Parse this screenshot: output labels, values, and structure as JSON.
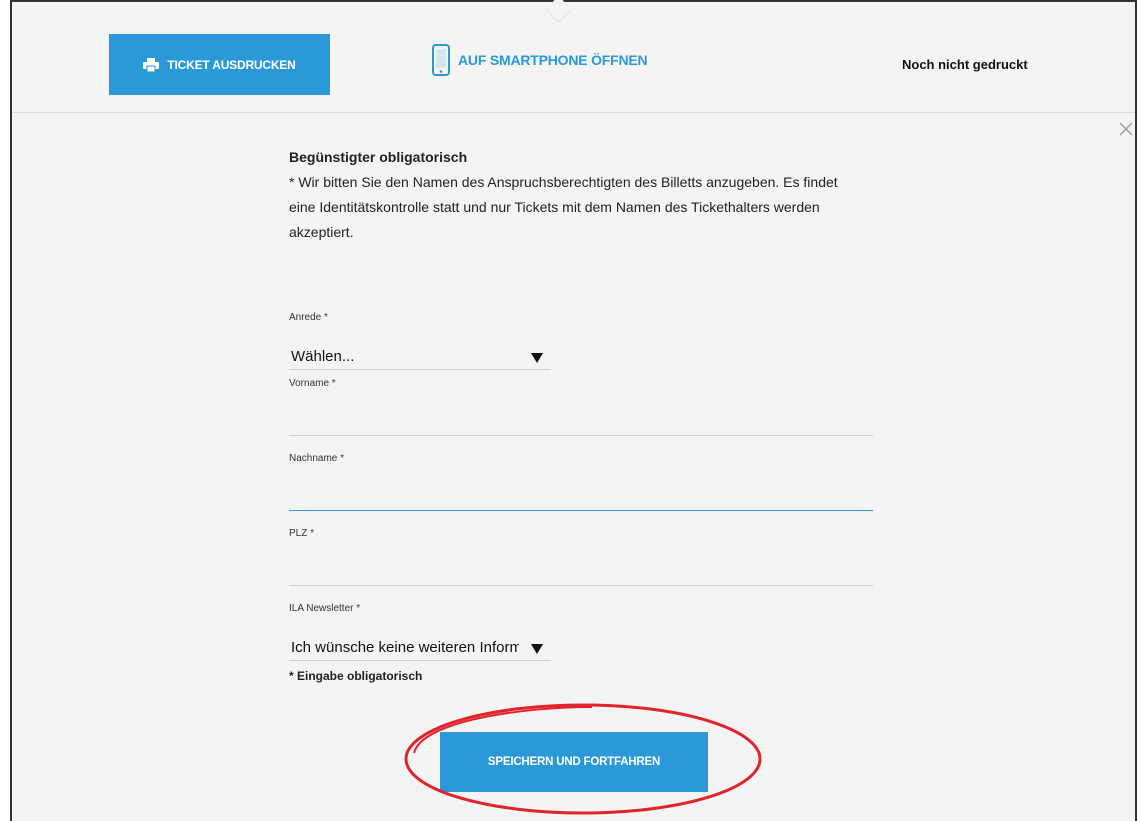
{
  "toolbar": {
    "print_button_label": "TICKET AUSDRUCKEN",
    "smartphone_label": "AUF SMARTPHONE ÖFFNEN",
    "print_status": "Noch nicht gedruckt"
  },
  "intro": {
    "heading": "Begünstigter obligatorisch",
    "text": "* Wir bitten Sie den Namen des Anspruchsberechtigten des Billetts anzugeben. Es findet eine Identitätskontrolle statt und nur Tickets mit dem Namen des Tickethalters werden akzeptiert."
  },
  "form": {
    "salutation": {
      "label": "Anrede *",
      "value": "Wählen..."
    },
    "firstname": {
      "label": "Vorname *",
      "value": ""
    },
    "lastname": {
      "label": "Nachname *",
      "value": ""
    },
    "zip": {
      "label": "PLZ *",
      "value": ""
    },
    "newsletter": {
      "label": "ILA Newsletter *",
      "value": "Ich wünsche keine weiteren Informationen"
    },
    "required_note": "* Eingabe obligatorisch",
    "submit_label": "SPEICHERN UND FORTFAHREN"
  },
  "colors": {
    "accent": "#2b98d8",
    "highlight": "#e0242b",
    "background": "#f4f4f4"
  }
}
